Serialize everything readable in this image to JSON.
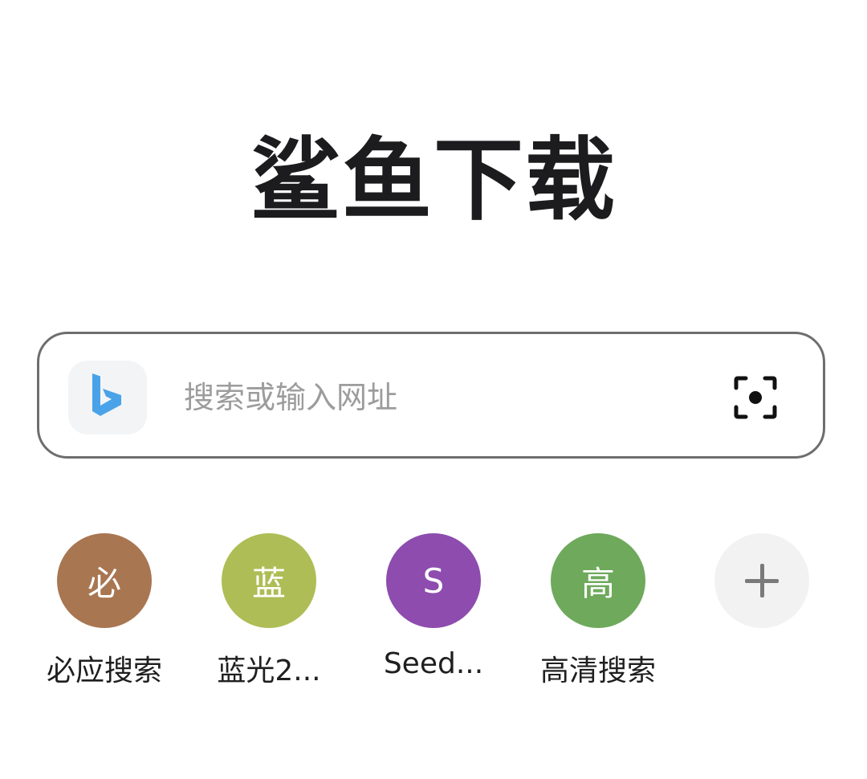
{
  "brand": {
    "title": "鲨鱼下载"
  },
  "search": {
    "placeholder": "搜索或输入网址",
    "engine_icon": "bing-icon",
    "scan_icon": "scan-icon",
    "engine_color": "#4aa3e8"
  },
  "shortcuts": [
    {
      "letter": "必",
      "label": "必应搜索",
      "color": "#a87651"
    },
    {
      "letter": "蓝",
      "label": "蓝光2...",
      "color": "#aebd55"
    },
    {
      "letter": "S",
      "label": "Seed...",
      "color": "#8d4cae"
    },
    {
      "letter": "高",
      "label": "高清搜索",
      "color": "#6ea95c"
    }
  ],
  "add_shortcut": {
    "icon": "plus-icon"
  }
}
